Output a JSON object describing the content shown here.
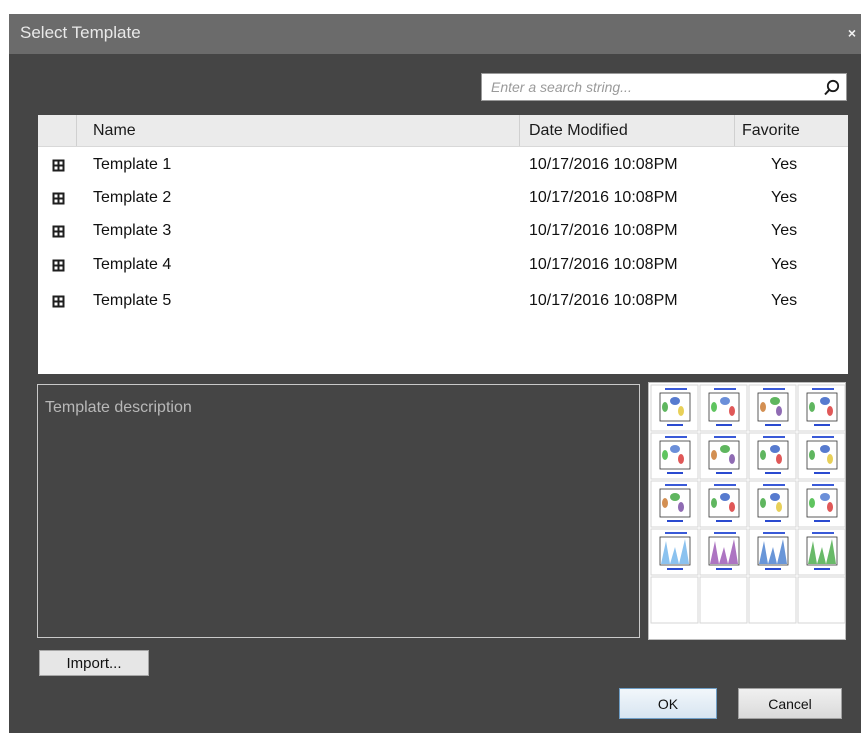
{
  "dialog": {
    "title": "Select Template",
    "close_glyph": "×"
  },
  "search": {
    "placeholder": "Enter a search string...",
    "value": "",
    "icon": "search-icon"
  },
  "table": {
    "columns": {
      "name": "Name",
      "date_modified": "Date Modified",
      "favorite": "Favorite"
    },
    "row_icon": "grid-icon",
    "rows": [
      {
        "name": "Template 1",
        "date_modified": "10/17/2016 10:08PM",
        "favorite": "Yes"
      },
      {
        "name": "Template 2",
        "date_modified": "10/17/2016 10:08PM",
        "favorite": "Yes"
      },
      {
        "name": "Template 3",
        "date_modified": "10/17/2016 10:08PM",
        "favorite": "Yes"
      },
      {
        "name": "Template 4",
        "date_modified": "10/17/2016 10:08PM",
        "favorite": "Yes"
      },
      {
        "name": "Template 5",
        "date_modified": "10/17/2016 10:08PM",
        "favorite": "Yes"
      }
    ]
  },
  "description": {
    "placeholder": "Template description"
  },
  "preview": {
    "icon": "template-preview-thumbnail"
  },
  "buttons": {
    "import": "Import...",
    "ok": "OK",
    "cancel": "Cancel"
  },
  "colors": {
    "dialog_bg": "#454545",
    "titlebar_bg": "#6b6b6b",
    "ok_border": "#6f9fc7"
  }
}
